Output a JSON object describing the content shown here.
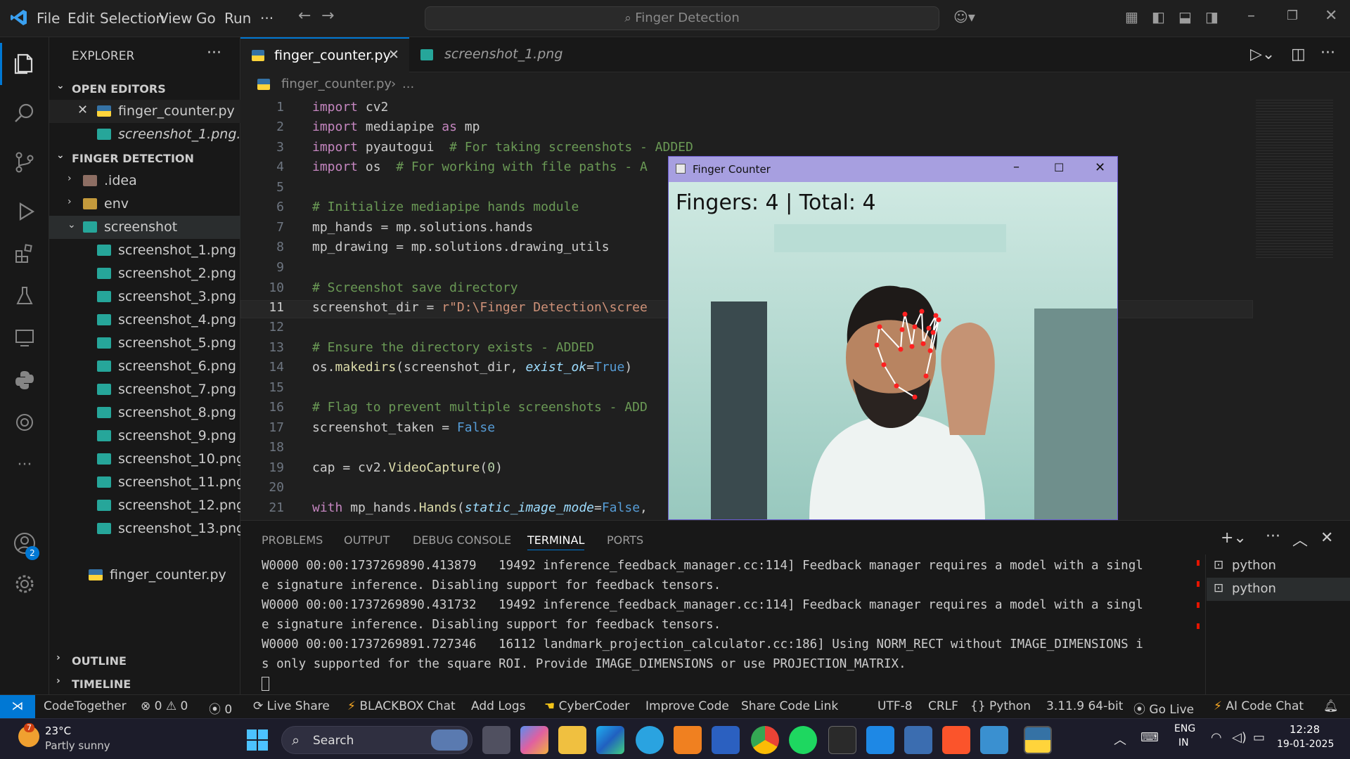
{
  "titlebar": {
    "menus": [
      "File",
      "Edit",
      "Selection",
      "View",
      "Go",
      "Run",
      "···"
    ],
    "command_center": "Finger Detection"
  },
  "sidebar": {
    "title": "EXPLORER",
    "open_editors_label": "OPEN EDITORS",
    "open_editors": [
      "finger_counter.py",
      "screenshot_1.png..."
    ],
    "folder_label": "FINGER DETECTION",
    "folders": [
      ".idea",
      "env",
      "screenshot"
    ],
    "screenshots": [
      "screenshot_1.png",
      "screenshot_2.png",
      "screenshot_3.png",
      "screenshot_4.png",
      "screenshot_5.png",
      "screenshot_6.png",
      "screenshot_7.png",
      "screenshot_8.png",
      "screenshot_9.png",
      "screenshot_10.png",
      "screenshot_11.png",
      "screenshot_12.png",
      "screenshot_13.png"
    ],
    "root_file": "finger_counter.py",
    "outline_label": "OUTLINE",
    "timeline_label": "TIMELINE"
  },
  "tabs": [
    {
      "label": "finger_counter.py",
      "active": true
    },
    {
      "label": "screenshot_1.png",
      "active": false
    }
  ],
  "breadcrumb": {
    "file": "finger_counter.py",
    "more": "..."
  },
  "code_lines": [
    "1",
    "2",
    "3",
    "4",
    "5",
    "6",
    "7",
    "8",
    "9",
    "10",
    "11",
    "12",
    "13",
    "14",
    "15",
    "16",
    "17",
    "18",
    "19",
    "20",
    "21"
  ],
  "code": {
    "l1": "import",
    "l1b": " cv2",
    "l2": "import",
    "l2b": " mediapipe ",
    "l2c": "as",
    "l2d": " mp",
    "l3": "import",
    "l3b": " pyautogui  ",
    "l3c": "# For taking screenshots - ADDED",
    "l4": "import",
    "l4b": " os  ",
    "l4c": "# For working with file paths - A",
    "l6": "# Initialize mediapipe hands module",
    "l7": "mp_hands = mp.solutions.hands",
    "l8": "mp_drawing = mp.solutions.drawing_utils",
    "l10": "# Screenshot save directory",
    "l11a": "screenshot_dir = ",
    "l11b": "r\"D:\\Finger Detection\\scree",
    "l13": "# Ensure the directory exists - ADDED",
    "l14a": "os.",
    "l14b": "makedirs",
    "l14c": "(screenshot_dir, ",
    "l14d": "exist_ok",
    "l14e": "=",
    "l14f": "True",
    "l14g": ")",
    "l16": "# Flag to prevent multiple screenshots - ADD",
    "l17a": "screenshot_taken = ",
    "l17b": "False",
    "l19a": "cap = cv2.",
    "l19b": "VideoCapture",
    "l19c": "(",
    "l19d": "0",
    "l19e": ")",
    "l21a": "with",
    "l21b": " mp_hands.",
    "l21c": "Hands",
    "l21d": "(",
    "l21e": "static_image_mode",
    "l21f": "=",
    "l21g": "False",
    "l21h": ","
  },
  "camera_window": {
    "title": "Finger Counter",
    "overlay": "Fingers: 4 | Total: 4"
  },
  "panel": {
    "tabs": [
      "PROBLEMS",
      "OUTPUT",
      "DEBUG CONSOLE",
      "TERMINAL",
      "PORTS"
    ],
    "active_tab": "TERMINAL",
    "terminal_lines": [
      "W0000 00:00:1737269890.413879   19492 inference_feedback_manager.cc:114] Feedback manager requires a model with a singl",
      "e signature inference. Disabling support for feedback tensors.",
      "W0000 00:00:1737269890.431732   19492 inference_feedback_manager.cc:114] Feedback manager requires a model with a singl",
      "e signature inference. Disabling support for feedback tensors.",
      "W0000 00:00:1737269891.727346   16112 landmark_projection_calculator.cc:186] Using NORM_RECT without IMAGE_DIMENSIONS i",
      "s only supported for the square ROI. Provide IMAGE_DIMENSIONS or use PROJECTION_MATRIX."
    ],
    "terminals": [
      "python",
      "python"
    ]
  },
  "statusbar": {
    "remote": "CodeTogether",
    "errors": "0",
    "warnings": "0",
    "ports": "0",
    "items": [
      "Live Share",
      "BLACKBOX Chat",
      "Add Logs",
      "CyberCoder",
      "Improve Code",
      "Share Code Link"
    ],
    "right": [
      "UTF-8",
      "CRLF",
      "{} Python",
      "3.11.9 64-bit",
      "Go Live",
      "AI Code Chat"
    ]
  },
  "taskbar": {
    "weather_temp": "23°C",
    "weather_desc": "Partly sunny",
    "weather_badge": "7",
    "search": "Search",
    "lang": "ENG",
    "region": "IN",
    "time": "12:28",
    "date": "19-01-2025"
  },
  "account_badge": "2",
  "colors": {
    "accent": "#0078d4",
    "bg": "#1f1f1f",
    "sidebar": "#181818"
  }
}
